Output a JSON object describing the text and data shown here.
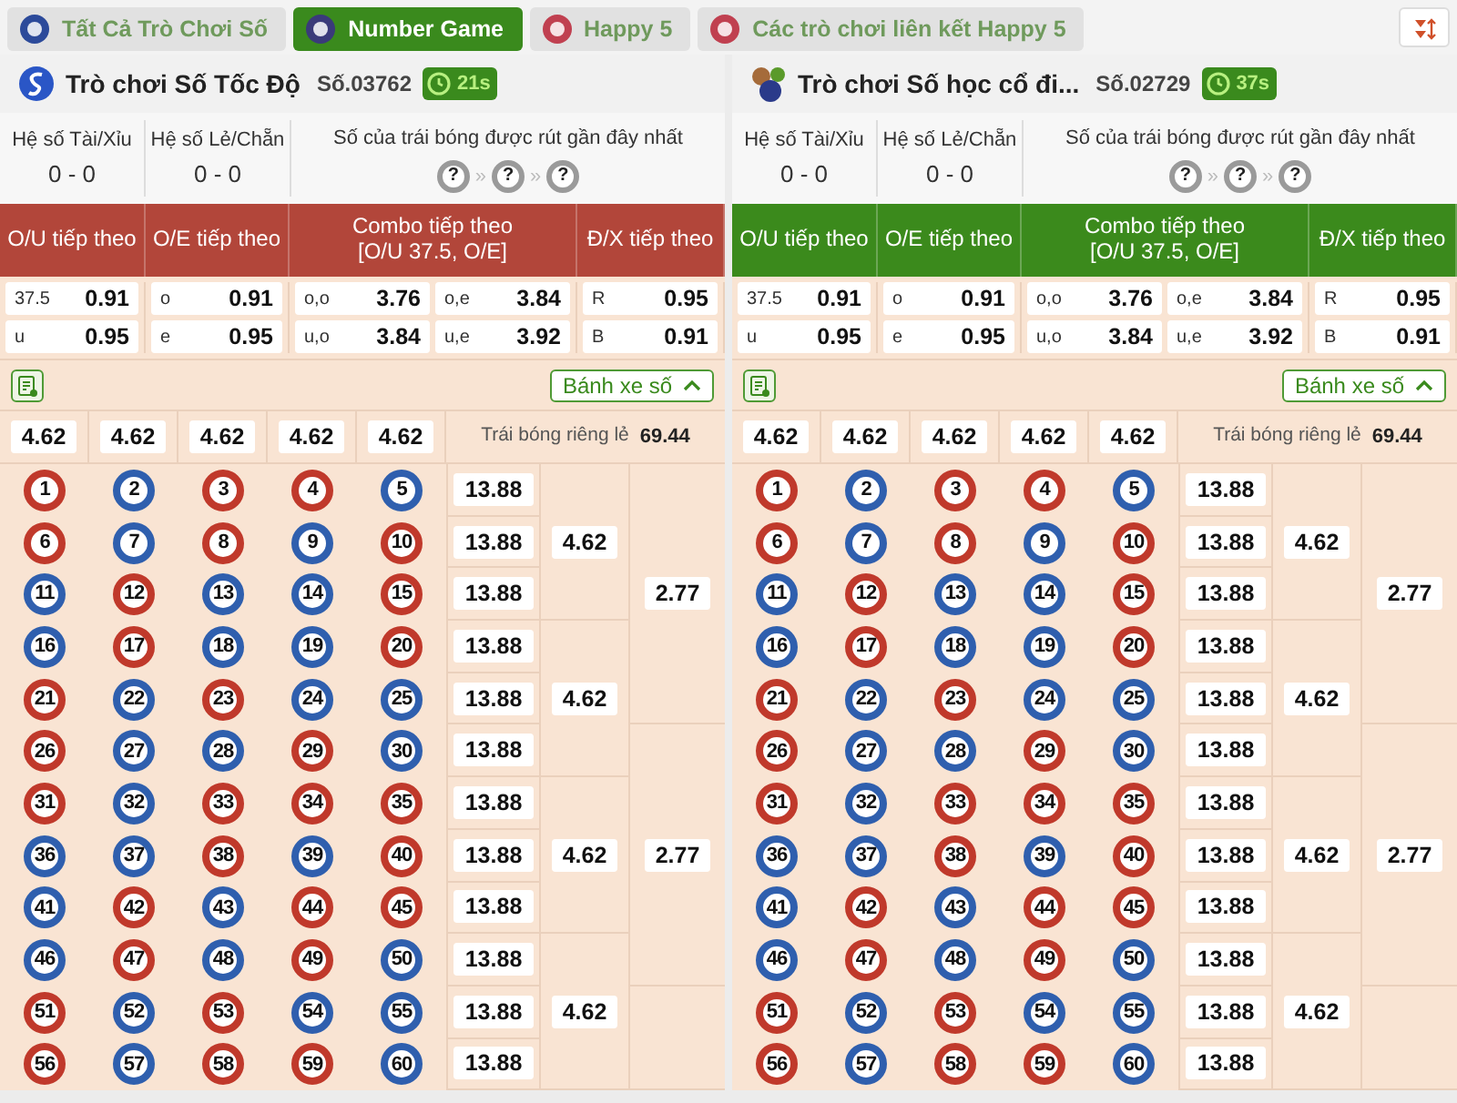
{
  "tabs": [
    {
      "label": "Tất Cả Trò Chơi Số",
      "selected": false
    },
    {
      "label": "Number Game",
      "selected": true
    },
    {
      "label": "Happy 5",
      "selected": false
    },
    {
      "label": "Các trò chơi liên kết Happy 5",
      "selected": false
    }
  ],
  "panels": [
    {
      "title": "Trò chơi Số Tốc Độ",
      "draw_no": "Số.03762",
      "timer": "21s",
      "color": "#b2463a",
      "stats": [
        {
          "label": "Hệ số Tài/Xỉu",
          "value": "0 - 0"
        },
        {
          "label": "Hệ số Lẻ/Chẵn",
          "value": "0 - 0"
        }
      ],
      "recent_label": "Số của trái bóng được rút gần đây nhất",
      "recent_balls": [
        "?",
        "?",
        "?"
      ],
      "recent_separators": [
        "»",
        "»"
      ],
      "bet_headers": [
        {
          "title": "O/U tiếp theo"
        },
        {
          "title": "O/E tiếp theo"
        },
        {
          "title": "Combo tiếp theo",
          "subtitle": "[O/U 37.5, O/E]"
        },
        {
          "title": "Đ/X tiếp theo"
        }
      ],
      "odds": [
        [
          {
            "label": "37.5",
            "value": "0.91"
          },
          {
            "label": "u",
            "value": "0.95"
          }
        ],
        [
          {
            "label": "o",
            "value": "0.91"
          },
          {
            "label": "e",
            "value": "0.95"
          }
        ],
        [
          {
            "label": "o,o",
            "value": "3.76"
          },
          {
            "label": "o,e",
            "value": "3.84"
          },
          {
            "label": "u,o",
            "value": "3.84"
          },
          {
            "label": "u,e",
            "value": "3.92"
          }
        ],
        [
          {
            "label": "R",
            "value": "0.95"
          },
          {
            "label": "B",
            "value": "0.91"
          }
        ]
      ],
      "wheel_button": "Bánh xe số",
      "column_odds": [
        "4.62",
        "4.62",
        "4.62",
        "4.62",
        "4.62"
      ],
      "single_ball": {
        "label": "Trái bóng riêng lẻ",
        "value": "69.44"
      },
      "row_odds": [
        "13.88",
        "13.88",
        "13.88",
        "13.88",
        "13.88",
        "13.88",
        "13.88",
        "13.88",
        "13.88",
        "13.88",
        "13.88",
        "13.88"
      ],
      "three_row_odds": [
        "4.62",
        "4.62",
        "4.62",
        "4.62"
      ],
      "five_row_odds": [
        "2.77",
        "2.77"
      ],
      "balls": [
        {
          "number": "1",
          "color": "#c0392b"
        },
        {
          "number": "2",
          "color": "#2f5fae"
        },
        {
          "number": "3",
          "color": "#c0392b"
        },
        {
          "number": "4",
          "color": "#c0392b"
        },
        {
          "number": "5",
          "color": "#2f5fae"
        },
        {
          "number": "6",
          "color": "#c0392b"
        },
        {
          "number": "7",
          "color": "#2f5fae"
        },
        {
          "number": "8",
          "color": "#c0392b"
        },
        {
          "number": "9",
          "color": "#2f5fae"
        },
        {
          "number": "10",
          "color": "#c0392b"
        },
        {
          "number": "11",
          "color": "#2f5fae"
        },
        {
          "number": "12",
          "color": "#c0392b"
        },
        {
          "number": "13",
          "color": "#2f5fae"
        },
        {
          "number": "14",
          "color": "#2f5fae"
        },
        {
          "number": "15",
          "color": "#c0392b"
        },
        {
          "number": "16",
          "color": "#2f5fae"
        },
        {
          "number": "17",
          "color": "#c0392b"
        },
        {
          "number": "18",
          "color": "#2f5fae"
        },
        {
          "number": "19",
          "color": "#2f5fae"
        },
        {
          "number": "20",
          "color": "#c0392b"
        },
        {
          "number": "21",
          "color": "#c0392b"
        },
        {
          "number": "22",
          "color": "#2f5fae"
        },
        {
          "number": "23",
          "color": "#c0392b"
        },
        {
          "number": "24",
          "color": "#2f5fae"
        },
        {
          "number": "25",
          "color": "#2f5fae"
        },
        {
          "number": "26",
          "color": "#c0392b"
        },
        {
          "number": "27",
          "color": "#2f5fae"
        },
        {
          "number": "28",
          "color": "#2f5fae"
        },
        {
          "number": "29",
          "color": "#c0392b"
        },
        {
          "number": "30",
          "color": "#2f5fae"
        },
        {
          "number": "31",
          "color": "#c0392b"
        },
        {
          "number": "32",
          "color": "#2f5fae"
        },
        {
          "number": "33",
          "color": "#c0392b"
        },
        {
          "number": "34",
          "color": "#c0392b"
        },
        {
          "number": "35",
          "color": "#c0392b"
        },
        {
          "number": "36",
          "color": "#2f5fae"
        },
        {
          "number": "37",
          "color": "#2f5fae"
        },
        {
          "number": "38",
          "color": "#c0392b"
        },
        {
          "number": "39",
          "color": "#2f5fae"
        },
        {
          "number": "40",
          "color": "#c0392b"
        },
        {
          "number": "41",
          "color": "#2f5fae"
        },
        {
          "number": "42",
          "color": "#c0392b"
        },
        {
          "number": "43",
          "color": "#2f5fae"
        },
        {
          "number": "44",
          "color": "#c0392b"
        },
        {
          "number": "45",
          "color": "#c0392b"
        },
        {
          "number": "46",
          "color": "#2f5fae"
        },
        {
          "number": "47",
          "color": "#c0392b"
        },
        {
          "number": "48",
          "color": "#2f5fae"
        },
        {
          "number": "49",
          "color": "#c0392b"
        },
        {
          "number": "50",
          "color": "#2f5fae"
        },
        {
          "number": "51",
          "color": "#c0392b"
        },
        {
          "number": "52",
          "color": "#2f5fae"
        },
        {
          "number": "53",
          "color": "#c0392b"
        },
        {
          "number": "54",
          "color": "#2f5fae"
        },
        {
          "number": "55",
          "color": "#2f5fae"
        },
        {
          "number": "56",
          "color": "#c0392b"
        },
        {
          "number": "57",
          "color": "#2f5fae"
        },
        {
          "number": "58",
          "color": "#c0392b"
        },
        {
          "number": "59",
          "color": "#c0392b"
        },
        {
          "number": "60",
          "color": "#2f5fae"
        }
      ]
    },
    {
      "title": "Trò chơi Số học cổ đi...",
      "draw_no": "Số.02729",
      "timer": "37s",
      "color": "#3b8a1c",
      "stats": [
        {
          "label": "Hệ số Tài/Xỉu",
          "value": "0 - 0"
        },
        {
          "label": "Hệ số Lẻ/Chẵn",
          "value": "0 - 0"
        }
      ],
      "recent_label": "Số của trái bóng được rút gần đây nhất",
      "recent_balls": [
        "?",
        "?",
        "?"
      ],
      "recent_separators": [
        "»",
        "»"
      ],
      "bet_headers": [
        {
          "title": "O/U tiếp theo"
        },
        {
          "title": "O/E tiếp theo"
        },
        {
          "title": "Combo tiếp theo",
          "subtitle": "[O/U 37.5, O/E]"
        },
        {
          "title": "Đ/X tiếp theo"
        }
      ],
      "odds": [
        [
          {
            "label": "37.5",
            "value": "0.91"
          },
          {
            "label": "u",
            "value": "0.95"
          }
        ],
        [
          {
            "label": "o",
            "value": "0.91"
          },
          {
            "label": "e",
            "value": "0.95"
          }
        ],
        [
          {
            "label": "o,o",
            "value": "3.76"
          },
          {
            "label": "o,e",
            "value": "3.84"
          },
          {
            "label": "u,o",
            "value": "3.84"
          },
          {
            "label": "u,e",
            "value": "3.92"
          }
        ],
        [
          {
            "label": "R",
            "value": "0.95"
          },
          {
            "label": "B",
            "value": "0.91"
          }
        ]
      ],
      "wheel_button": "Bánh xe số",
      "column_odds": [
        "4.62",
        "4.62",
        "4.62",
        "4.62",
        "4.62"
      ],
      "single_ball": {
        "label": "Trái bóng riêng lẻ",
        "value": "69.44"
      },
      "row_odds": [
        "13.88",
        "13.88",
        "13.88",
        "13.88",
        "13.88",
        "13.88",
        "13.88",
        "13.88",
        "13.88",
        "13.88",
        "13.88",
        "13.88"
      ],
      "three_row_odds": [
        "4.62",
        "4.62",
        "4.62",
        "4.62"
      ],
      "five_row_odds": [
        "2.77",
        "2.77"
      ],
      "balls": [
        {
          "number": "1",
          "color": "#c0392b"
        },
        {
          "number": "2",
          "color": "#2f5fae"
        },
        {
          "number": "3",
          "color": "#c0392b"
        },
        {
          "number": "4",
          "color": "#c0392b"
        },
        {
          "number": "5",
          "color": "#2f5fae"
        },
        {
          "number": "6",
          "color": "#c0392b"
        },
        {
          "number": "7",
          "color": "#2f5fae"
        },
        {
          "number": "8",
          "color": "#c0392b"
        },
        {
          "number": "9",
          "color": "#2f5fae"
        },
        {
          "number": "10",
          "color": "#c0392b"
        },
        {
          "number": "11",
          "color": "#2f5fae"
        },
        {
          "number": "12",
          "color": "#c0392b"
        },
        {
          "number": "13",
          "color": "#2f5fae"
        },
        {
          "number": "14",
          "color": "#2f5fae"
        },
        {
          "number": "15",
          "color": "#c0392b"
        },
        {
          "number": "16",
          "color": "#2f5fae"
        },
        {
          "number": "17",
          "color": "#c0392b"
        },
        {
          "number": "18",
          "color": "#2f5fae"
        },
        {
          "number": "19",
          "color": "#2f5fae"
        },
        {
          "number": "20",
          "color": "#c0392b"
        },
        {
          "number": "21",
          "color": "#c0392b"
        },
        {
          "number": "22",
          "color": "#2f5fae"
        },
        {
          "number": "23",
          "color": "#c0392b"
        },
        {
          "number": "24",
          "color": "#2f5fae"
        },
        {
          "number": "25",
          "color": "#2f5fae"
        },
        {
          "number": "26",
          "color": "#c0392b"
        },
        {
          "number": "27",
          "color": "#2f5fae"
        },
        {
          "number": "28",
          "color": "#2f5fae"
        },
        {
          "number": "29",
          "color": "#c0392b"
        },
        {
          "number": "30",
          "color": "#2f5fae"
        },
        {
          "number": "31",
          "color": "#c0392b"
        },
        {
          "number": "32",
          "color": "#2f5fae"
        },
        {
          "number": "33",
          "color": "#c0392b"
        },
        {
          "number": "34",
          "color": "#c0392b"
        },
        {
          "number": "35",
          "color": "#c0392b"
        },
        {
          "number": "36",
          "color": "#2f5fae"
        },
        {
          "number": "37",
          "color": "#2f5fae"
        },
        {
          "number": "38",
          "color": "#c0392b"
        },
        {
          "number": "39",
          "color": "#2f5fae"
        },
        {
          "number": "40",
          "color": "#c0392b"
        },
        {
          "number": "41",
          "color": "#2f5fae"
        },
        {
          "number": "42",
          "color": "#c0392b"
        },
        {
          "number": "43",
          "color": "#2f5fae"
        },
        {
          "number": "44",
          "color": "#c0392b"
        },
        {
          "number": "45",
          "color": "#c0392b"
        },
        {
          "number": "46",
          "color": "#2f5fae"
        },
        {
          "number": "47",
          "color": "#c0392b"
        },
        {
          "number": "48",
          "color": "#2f5fae"
        },
        {
          "number": "49",
          "color": "#c0392b"
        },
        {
          "number": "50",
          "color": "#2f5fae"
        },
        {
          "number": "51",
          "color": "#c0392b"
        },
        {
          "number": "52",
          "color": "#2f5fae"
        },
        {
          "number": "53",
          "color": "#c0392b"
        },
        {
          "number": "54",
          "color": "#2f5fae"
        },
        {
          "number": "55",
          "color": "#2f5fae"
        },
        {
          "number": "56",
          "color": "#c0392b"
        },
        {
          "number": "57",
          "color": "#2f5fae"
        },
        {
          "number": "58",
          "color": "#c0392b"
        },
        {
          "number": "59",
          "color": "#c0392b"
        },
        {
          "number": "60",
          "color": "#2f5fae"
        }
      ]
    }
  ]
}
